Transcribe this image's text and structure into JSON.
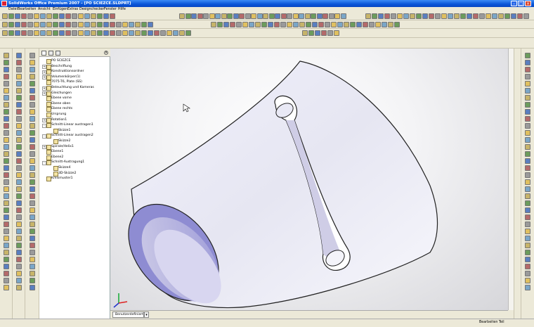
{
  "window": {
    "title": "SolidWorks Office Premium 2007 - [PO SCIEZCE.SLDPRT]"
  },
  "menu": [
    "Datei",
    "Bearbeiten",
    "Ansicht",
    "Einfügen",
    "Extras",
    "Designchecker",
    "Fenster",
    "Hilfe"
  ],
  "tree": {
    "root": "PO SCIEZCE",
    "items": [
      {
        "label": "Beschriftung",
        "expand": "+"
      },
      {
        "label": "Konstruktionsordner",
        "expand": "+"
      },
      {
        "label": "Volumenkörper(1)",
        "expand": "+"
      },
      {
        "label": "7075-T6, Plate (SS)",
        "expand": ""
      },
      {
        "label": "Beleuchtung und Kameras",
        "expand": "+"
      },
      {
        "label": "Gleichungen",
        "expand": "+"
      },
      {
        "label": "Ebene vorne",
        "expand": ""
      },
      {
        "label": "Ebene oben",
        "expand": ""
      },
      {
        "label": "Ebene rechts",
        "expand": ""
      },
      {
        "label": "Ursprung",
        "expand": ""
      },
      {
        "label": "Rotation1",
        "expand": "+"
      },
      {
        "label": "Schnitt-Linear austragen1",
        "expand": "-"
      },
      {
        "label": "Skizze1",
        "expand": "",
        "indent": 1
      },
      {
        "label": "Schnitt-Linear austragen2",
        "expand": "-"
      },
      {
        "label": "Skizze2",
        "expand": "",
        "indent": 1
      },
      {
        "label": "Spirale/Helix1",
        "expand": "+"
      },
      {
        "label": "Ebene1",
        "expand": ""
      },
      {
        "label": "Ebene2",
        "expand": ""
      },
      {
        "label": "Schnitt-Austragung1",
        "expand": "-"
      },
      {
        "label": "Skizze4",
        "expand": "",
        "indent": 1
      },
      {
        "label": "3D-Skizze2",
        "expand": "",
        "indent": 1
      },
      {
        "label": "Kreismuster1",
        "expand": ""
      }
    ]
  },
  "viewport": {
    "tab_label": "Benutzerdefiniert"
  },
  "status": {
    "text": "Bearbeiten Teil"
  },
  "colors": {
    "title_bar": "#0a55d8",
    "part": "#e6e6f5",
    "part_inner": "#b8b6e8"
  }
}
